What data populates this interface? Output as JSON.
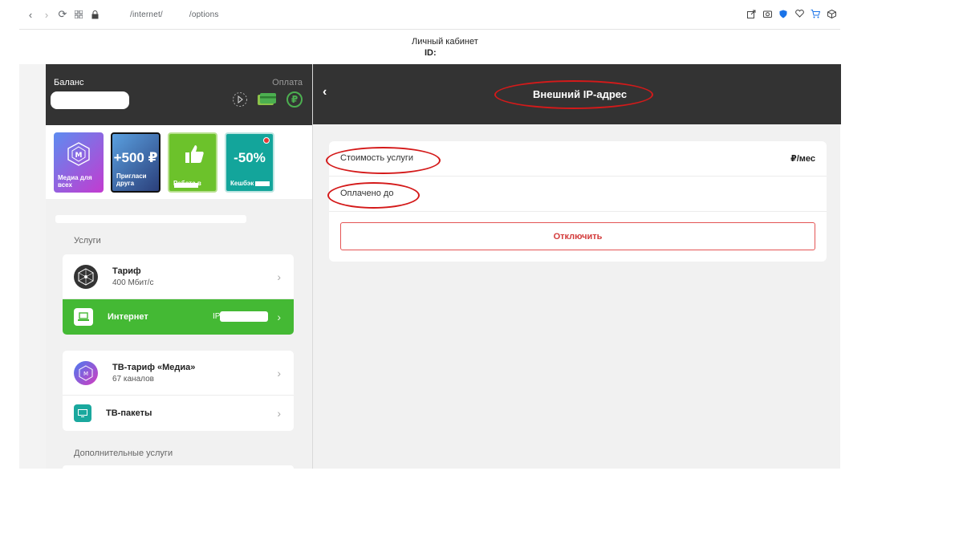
{
  "browser": {
    "url_segments": [
      "/internet/",
      "/options"
    ],
    "back_glyph": "‹",
    "forward_glyph": "›",
    "reload_glyph": "⟳"
  },
  "cabinet": {
    "title": "Личный кабинет",
    "id_label": "ID:"
  },
  "balance": {
    "label": "Баланс",
    "pay_label": "Оплата"
  },
  "promos": [
    {
      "caption": "Медиа для всех",
      "big": ""
    },
    {
      "caption": "Пригласи друга",
      "big": "+500 ₽"
    },
    {
      "caption": "Работа в",
      "big": ""
    },
    {
      "caption": "Кешбэк",
      "big": "-50%"
    }
  ],
  "services": {
    "section_label": "Услуги",
    "tariff_title": "Тариф",
    "tariff_sub": "400 Мбит/с",
    "internet_title": "Интернет",
    "internet_value": "IP",
    "tv_title": "ТВ-тариф «Медиа»",
    "tv_sub": "67 каналов",
    "tvpack_title": "ТВ-пакеты",
    "extra_label": "Дополнительные услуги"
  },
  "detail": {
    "back_glyph": "‹",
    "title": "Внешний IP-адрес",
    "cost_label": "Стоимость услуги",
    "cost_value": "₽/мес",
    "paid_label": "Оплачено до",
    "disable_button": "Отключить"
  },
  "colors": {
    "dark": "#333333",
    "green": "#44b934",
    "annotation_red": "#d41a1a",
    "danger": "#d33b3b"
  }
}
